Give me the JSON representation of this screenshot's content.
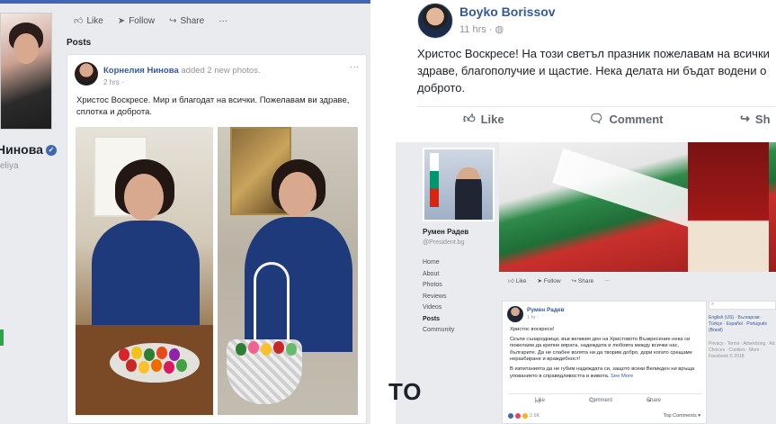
{
  "left_post": {
    "actions": [
      "Like",
      "Follow",
      "Share",
      "···"
    ],
    "posts_heading": "Posts",
    "profile_name": "Нинова",
    "profile_username": "eliya",
    "author": "Корнелия Нинова",
    "activity": "added 2 new photos.",
    "time": "2 hrs ·",
    "text": "Христос Воскресе. Мир и благодат на всички. Пожелавам ви здраве, сплотка и доброта."
  },
  "right_post": {
    "name": "Boyko Borissov",
    "meta": "11 hrs ·",
    "text_line1": "Христос Воскресе! На този светъл празник пожелавам на всички",
    "text_line2": "здраве, благополучие и щастие. Нека делата ни бъдат водени о",
    "text_line3": "доброто.",
    "like": "Like",
    "comment": "Comment",
    "share": "Sh"
  },
  "radev_page": {
    "page_name": "Румен Радев",
    "username": "@President.bg",
    "nav": [
      "Home",
      "About",
      "Photos",
      "Reviews",
      "Videos",
      "Posts",
      "Community"
    ],
    "actions": [
      "Like",
      "Follow",
      "Share",
      "···"
    ],
    "post_author": "Румен Радев",
    "post_meta": "1 hr ·",
    "post_p1": "Христос воскресе!",
    "post_p2": "Скъпи сънародници, във великия ден на Христовото Възкресение нека си пожелаем да крепне вярата, надеждата и любовта между всички нас, българите. Да не слабее волята ни да творим добро, дори когато срещаме неразбиране и враждебност!",
    "post_p3": "В изпитанията да не губим надеждата си, защото всеки Великден ни връща упованието в справедливостта и живота.",
    "see_more": "See More",
    "like": "Like",
    "comment": "Comment",
    "share": "Share",
    "reactions_count": "2.6K",
    "top_comments": "Top Comments ▾",
    "side_langs": "English (US) · Български · Türkçe · Español · Português (Brasil)",
    "side_footer": "Privacy · Terms · Advertising · Ad Choices · Cookies · More · Facebook © 2018"
  },
  "bottom_text": "ТО",
  "colors": {
    "fb_blue": "#4267b2",
    "link_blue": "#365899",
    "bg_gray": "#e9ebee"
  }
}
